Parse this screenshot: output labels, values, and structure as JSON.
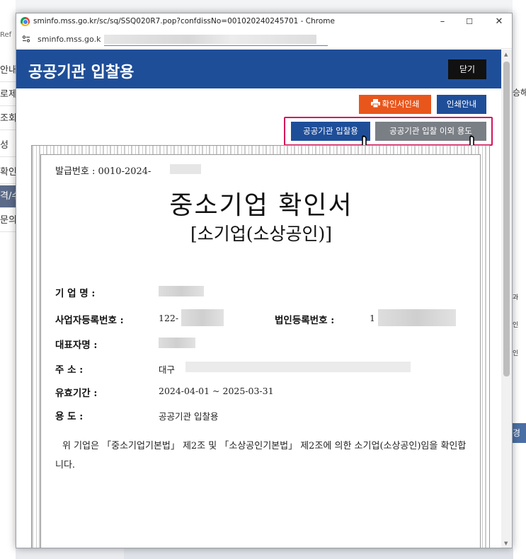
{
  "background": {
    "ref_label": "Ref",
    "left_items": [
      "안내",
      "로제",
      "조회",
      "성",
      "확인",
      "격/수",
      "문의"
    ],
    "right_texts": [
      "승해",
      "과",
      "인",
      "인"
    ],
    "right_button": "경"
  },
  "window": {
    "title": "sminfo.mss.go.kr/sc/sq/SSQ020R7.pop?confdissNo=001020240245701 - Chrome",
    "url": "sminfo.mss.go.k",
    "minimize": "–",
    "maximize": "☐",
    "close": "✕"
  },
  "header": {
    "title": "공공기관 입찰용",
    "close_label": "닫기"
  },
  "buttons": {
    "print_label": "확인서인쇄",
    "guide_label": "인쇄안내",
    "bid_label": "공공기관 입찰용",
    "other_label": "공공기관 입찰 이외 용도"
  },
  "certificate": {
    "issue_label": "발급번호 : 0010-2024-",
    "title": "중소기업 확인서",
    "subtitle": "[소기업(소상공인)]",
    "company_label": "기 업 명 :",
    "bizno_label": "사업자등록번호 :",
    "bizno_value": "122-",
    "corpno_label": "법인등록번호 :",
    "corpno_value": "1",
    "ceo_label": "대표자명 :",
    "address_label": "주    소 :",
    "address_value": "대구",
    "validity_label": "유효기간 :",
    "validity_value": "2024-04-01 ~ 2025-03-31",
    "purpose_label": "용    도 :",
    "purpose_value": "공공기관 입찰용",
    "statement": "위 기업은 「중소기업기본법」 제2조 및 「소상공인기본법」 제2조에 의한 소기업(소상공인)임을 확인합니다."
  },
  "icons": {
    "printer": "printer-icon",
    "hand": "pointing-hand-icon"
  }
}
